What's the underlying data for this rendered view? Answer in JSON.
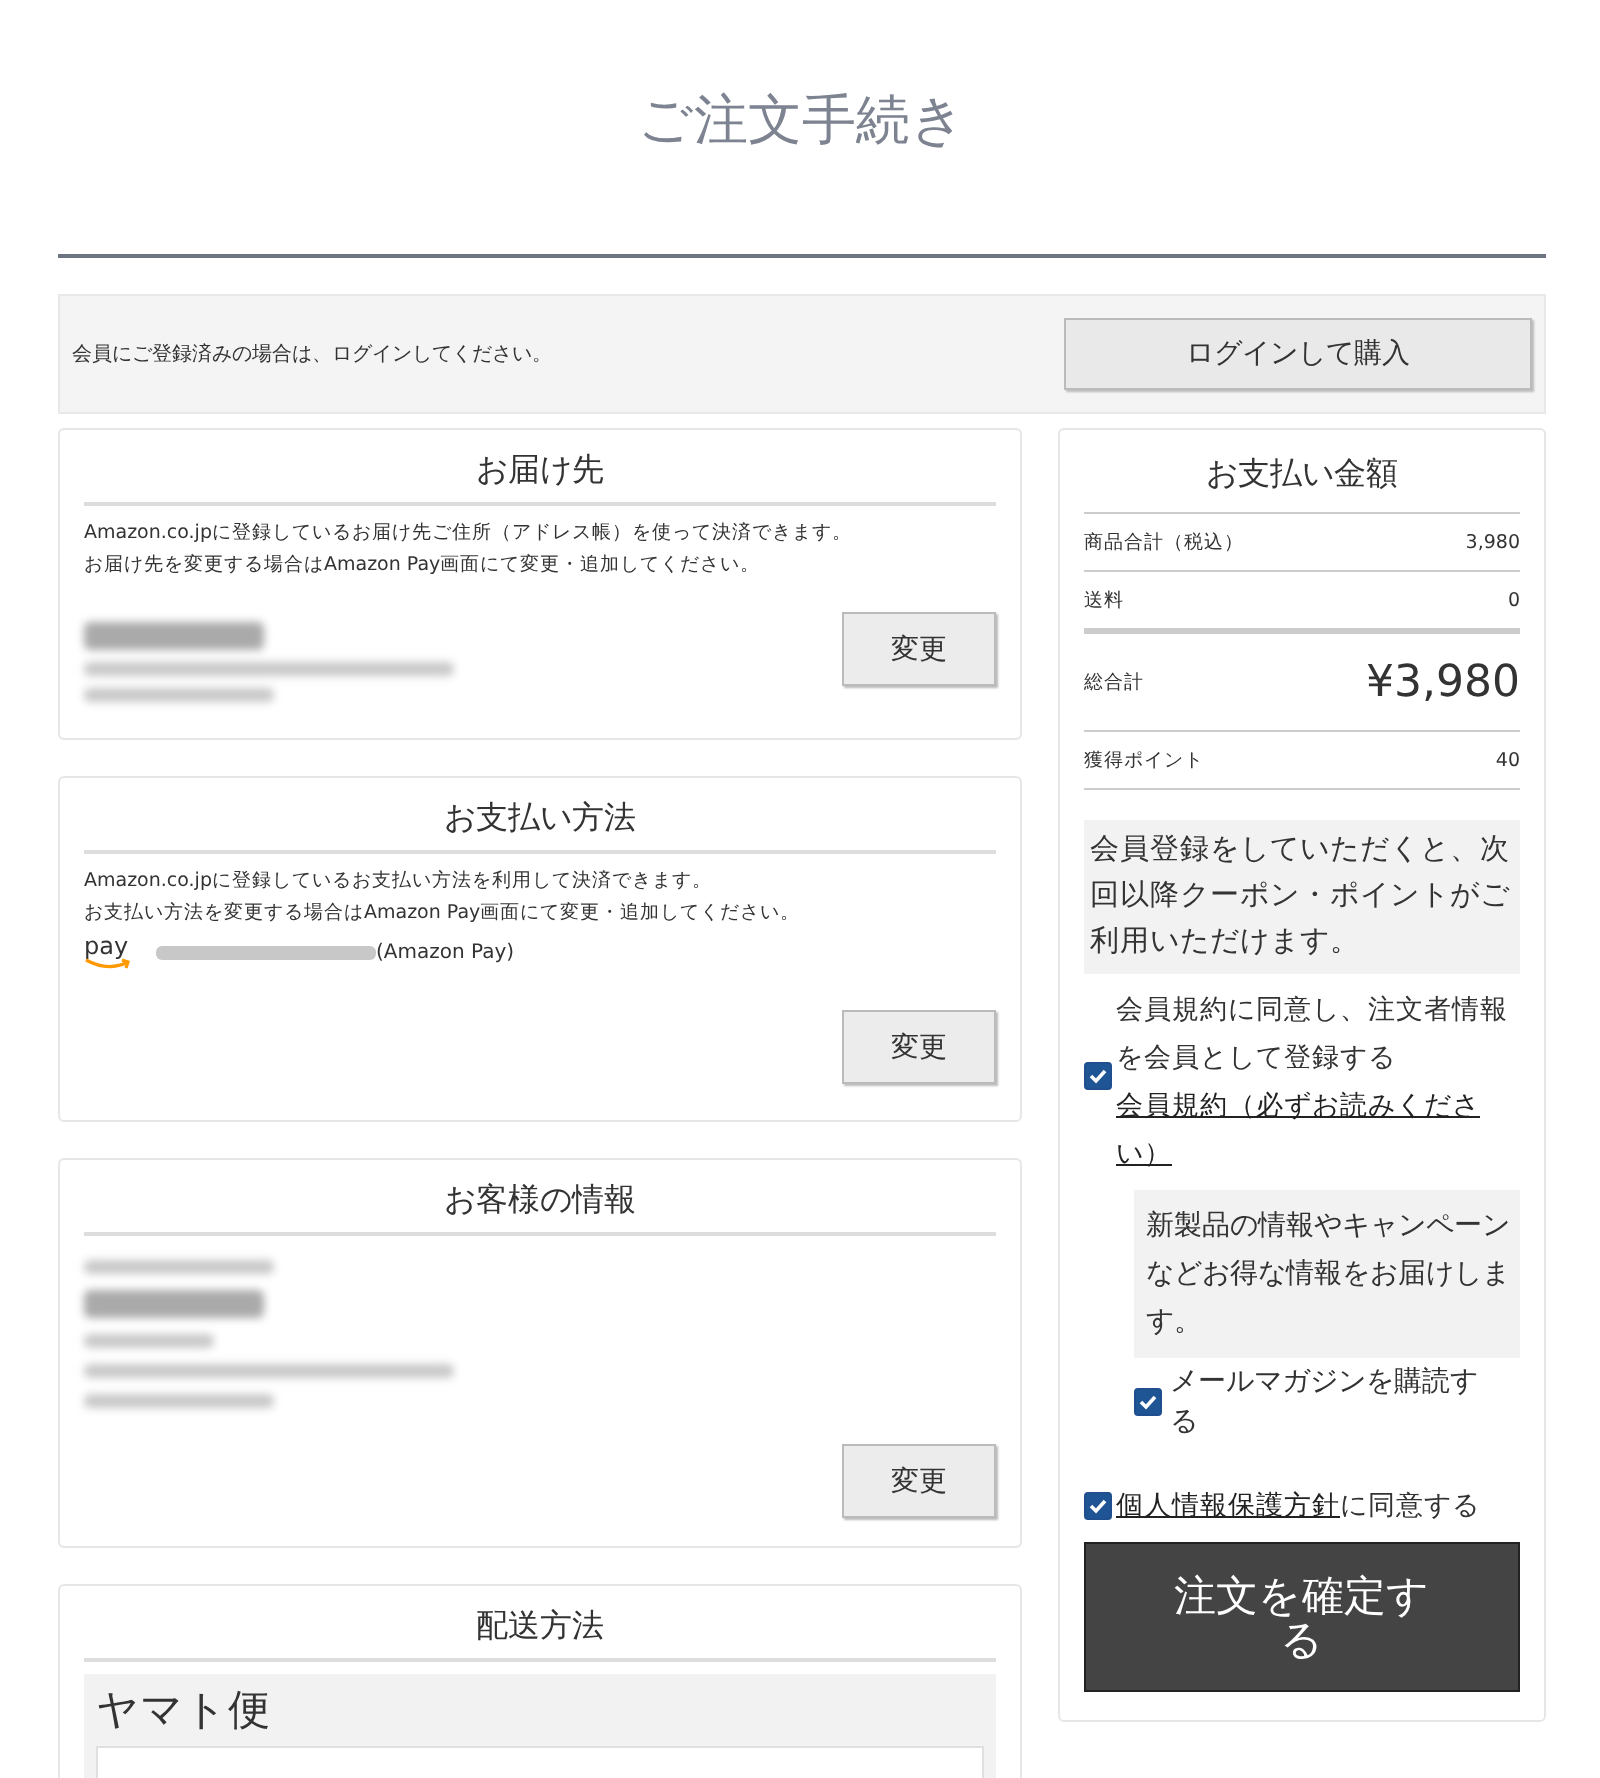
{
  "page_title": "ご注文手続き",
  "login": {
    "message": "会員にご登録済みの場合は、ログインしてください。",
    "button": "ログインして購入"
  },
  "sections": [
    {
      "kind": "address",
      "title": "お届け先",
      "notes": [
        "Amazon.co.jpに登録しているお届け先ご住所（アドレス帳）を使って決済できます。",
        "お届け先を変更する場合はAmazon Pay画面にて変更・追加してください。"
      ],
      "button": "変更"
    },
    {
      "kind": "payment",
      "title": "お支払い方法",
      "notes": [
        "Amazon.co.jpに登録しているお支払い方法を利用して決済できます。",
        "お支払い方法を変更する場合はAmazon Pay画面にて変更・追加してください。"
      ],
      "pay_logo": "pay",
      "pay_suffix": "(Amazon Pay)",
      "button": "変更"
    },
    {
      "kind": "customer",
      "title": "お客様の情報",
      "button": "変更"
    },
    {
      "kind": "delivery",
      "title": "配送方法",
      "carrier": "ヤマト便"
    }
  ],
  "summary": {
    "title": "お支払い金額",
    "rows": [
      {
        "kind": "line",
        "label": "商品合計（税込）",
        "value": "3,980"
      },
      {
        "kind": "line",
        "label": "送料",
        "value": "0"
      },
      {
        "kind": "total",
        "label": "総合計",
        "value": "¥3,980"
      },
      {
        "kind": "line",
        "label": "獲得ポイント",
        "value": "40"
      }
    ],
    "member_note": "会員登録をしていただくと、次回以降クーポン・ポイントがご利用いただけます。",
    "register": {
      "label": "会員規約に同意し、注文者情報を会員として登録する",
      "link": "会員規約（必ずお読みください）",
      "checked": true
    },
    "newsletter_note": "新製品の情報やキャンペーンなどお得な情報をお届けします。",
    "newsletter": {
      "label": "メールマガジンを購読する",
      "checked": true
    },
    "privacy": {
      "link": "個人情報保護方針",
      "suffix": "に同意する",
      "checked": true
    },
    "confirm_button": "注文を確定する"
  }
}
